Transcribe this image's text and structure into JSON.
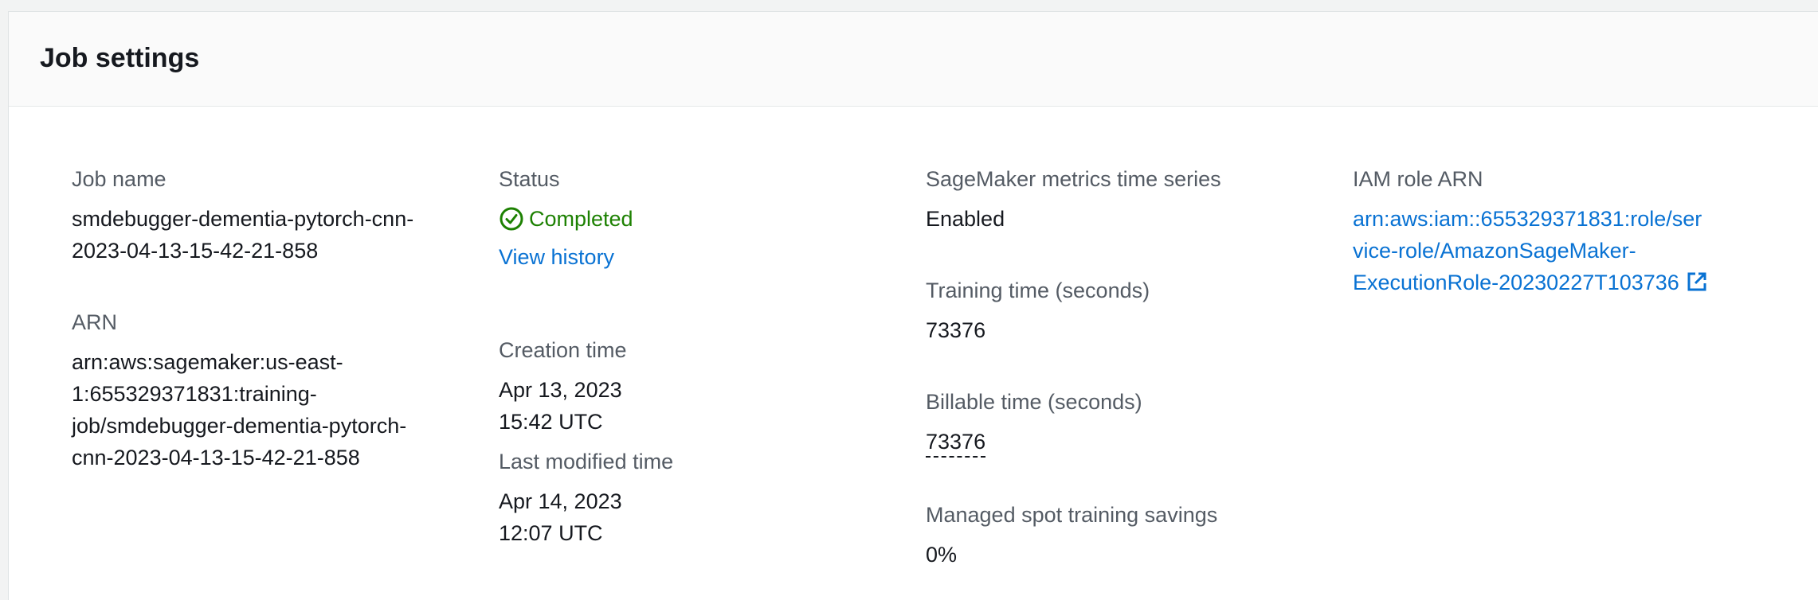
{
  "panel": {
    "title": "Job settings"
  },
  "job_name": {
    "label": "Job name",
    "line1": "smdebugger-dementia-pytorch-cnn-",
    "line2": "2023-04-13-15-42-21-858"
  },
  "arn": {
    "label": "ARN",
    "line1": "arn:aws:sagemaker:us-east-",
    "line2": "1:655329371831:training-",
    "line3": "job/smdebugger-dementia-pytorch-",
    "line4": "cnn-2023-04-13-15-42-21-858"
  },
  "status": {
    "label": "Status",
    "value": "Completed",
    "icon": "check-circle-icon",
    "color": "#1d8102",
    "history_link": "View history"
  },
  "creation_time": {
    "label": "Creation time",
    "value": "Apr 13, 2023 15:42 UTC"
  },
  "last_modified_time": {
    "label": "Last modified time",
    "value": "Apr 14, 2023 12:07 UTC"
  },
  "metrics_time_series": {
    "label": "SageMaker metrics time series",
    "value": "Enabled"
  },
  "training_time": {
    "label": "Training time (seconds)",
    "value": "73376"
  },
  "billable_time": {
    "label": "Billable time (seconds)",
    "value": "73376"
  },
  "spot_savings": {
    "label": "Managed spot training savings",
    "value": "0%"
  },
  "iam_role": {
    "label": "IAM role ARN",
    "line1": "arn:aws:iam::655329371831:role/ser",
    "line2": "vice-role/AmazonSageMaker-",
    "line3": "ExecutionRole-20230227T103736",
    "icon": "external-link-icon",
    "color": "#0972d3"
  }
}
